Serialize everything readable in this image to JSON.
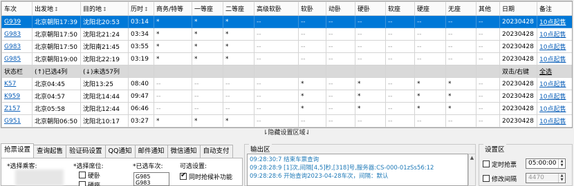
{
  "grid": {
    "columns": [
      {
        "label": "车次",
        "sort": ""
      },
      {
        "label": "出发地",
        "sort": "↕"
      },
      {
        "label": "目的地",
        "sort": "↕"
      },
      {
        "label": "历时",
        "sort": "↕"
      },
      {
        "label": "商务/特等",
        "sort": ""
      },
      {
        "label": "一等座",
        "sort": ""
      },
      {
        "label": "二等座",
        "sort": ""
      },
      {
        "label": "高级软卧",
        "sort": ""
      },
      {
        "label": "软卧",
        "sort": ""
      },
      {
        "label": "动卧",
        "sort": ""
      },
      {
        "label": "硬卧",
        "sort": ""
      },
      {
        "label": "软座",
        "sort": ""
      },
      {
        "label": "硬座",
        "sort": ""
      },
      {
        "label": "无座",
        "sort": ""
      },
      {
        "label": "其他",
        "sort": ""
      },
      {
        "label": "日期",
        "sort": ""
      },
      {
        "label": "备注",
        "sort": ""
      }
    ],
    "rows": [
      {
        "type": "selected",
        "cells": [
          "G939",
          "北京朝阳17:39",
          "沈阳北20:53",
          "03:14",
          "*",
          "*",
          "*",
          "--",
          "--",
          "--",
          "--",
          "--",
          "--",
          "--",
          "--",
          "20230428",
          "10点起售"
        ]
      },
      {
        "type": "normal",
        "cells": [
          "G983",
          "北京朝阳17:50",
          "沈阳北21:24",
          "03:34",
          "*",
          "*",
          "*",
          "--",
          "--",
          "--",
          "--",
          "--",
          "--",
          "--",
          "--",
          "20230428",
          "10点起售"
        ]
      },
      {
        "type": "normal",
        "cells": [
          "G983",
          "北京朝阳17:50",
          "沈阳南21:45",
          "03:55",
          "*",
          "*",
          "*",
          "--",
          "--",
          "--",
          "--",
          "--",
          "--",
          "--",
          "--",
          "20230428",
          "10点起售"
        ]
      },
      {
        "type": "normal",
        "cells": [
          "G985",
          "北京朝阳19:00",
          "沈阳北22:19",
          "03:19",
          "*",
          "*",
          "*",
          "--",
          "--",
          "--",
          "--",
          "--",
          "--",
          "--",
          "--",
          "20230428",
          "10点起售"
        ]
      },
      {
        "type": "status",
        "cells": [
          "状态栏",
          "(↑)已选4列",
          "(↓)未选57列",
          "",
          "",
          "",
          "",
          "",
          "",
          "",
          "",
          "",
          "",
          "",
          "",
          "双击/右键",
          "全选"
        ]
      },
      {
        "type": "normal",
        "cells": [
          "K57",
          "北京04:45",
          "沈阳13:25",
          "08:40",
          "--",
          "--",
          "--",
          "--",
          "*",
          "--",
          "*",
          "--",
          "*",
          "*",
          "--",
          "20230428",
          "10点起售"
        ]
      },
      {
        "type": "normal",
        "cells": [
          "K959",
          "北京04:57",
          "沈阳北14:44",
          "09:47",
          "--",
          "--",
          "--",
          "--",
          "*",
          "--",
          "*",
          "--",
          "*",
          "*",
          "--",
          "20230428",
          "10点起售"
        ]
      },
      {
        "type": "normal",
        "cells": [
          "Z157",
          "北京05:58",
          "沈阳北12:44",
          "06:46",
          "--",
          "--",
          "--",
          "--",
          "*",
          "--",
          "*",
          "--",
          "*",
          "*",
          "--",
          "20230428",
          "10点起售"
        ]
      },
      {
        "type": "normal",
        "cells": [
          "G951",
          "北京朝阳06:50",
          "沈阳北10:17",
          "03:27",
          "*",
          "*",
          "*",
          "--",
          "--",
          "--",
          "--",
          "--",
          "--",
          "--",
          "--",
          "20230428",
          "10点起售"
        ]
      }
    ]
  },
  "splitter_label": "⇂隐藏设置区域⇃",
  "tabs": [
    "抢票设置",
    "查询起售",
    "验证码设置",
    "QQ通知",
    "邮件通知",
    "微信通知",
    "自动支付"
  ],
  "ticket_settings": {
    "select_passenger_label": "*选择乘客:",
    "select_seat_label": "*选择席位:",
    "seat_options": [
      {
        "label": "硬卧",
        "checked": false
      },
      {
        "label": "硬座",
        "checked": false
      }
    ],
    "selected_trains_label": "*已选车次:",
    "selected_trains": [
      "G985",
      "G983"
    ],
    "optional_settings_label": "可选设置:",
    "simultaneous_label": "同时抢候补功能",
    "simultaneous_checked": true
  },
  "output": {
    "title": "输出区",
    "lines": [
      "09:28:30:7  结束车票查询",
      "09:28:28:9  [1]次,间隔[4,5]秒,[318]号,服务器:CS-000-01zSs56:12",
      "09:28:28:6  开始查询2023-04-28车次，间隔：默认"
    ]
  },
  "settings": {
    "title": "设置区",
    "scheduled_label": "定时抢票",
    "scheduled_checked": false,
    "scheduled_time": "05:00:00",
    "interval_label": "修改间隔",
    "interval_checked": false,
    "interval_value": "4470"
  },
  "colors": {
    "selection": "#0078d7",
    "status_row": "#d9d9d9",
    "link": "#0b5fb8",
    "log_text": "#1f7ab8"
  }
}
